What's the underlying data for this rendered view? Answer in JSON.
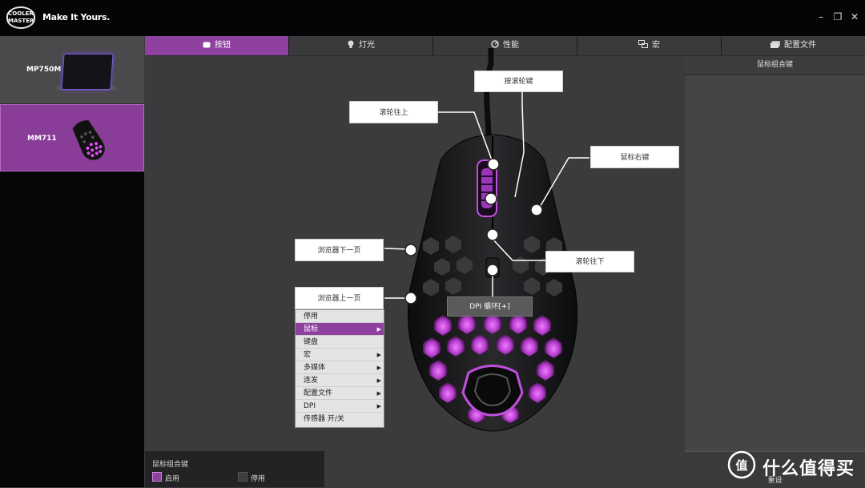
{
  "app": {
    "logo_text": "COOLER MASTER",
    "slogan": "Make It Yours."
  },
  "window_controls": {
    "minimize": "–",
    "restore": "❐",
    "close": "✕"
  },
  "devices": [
    {
      "name": "MP750M"
    },
    {
      "name": "MM711"
    }
  ],
  "tabs": [
    {
      "label": "按钮",
      "icon": "mouse-button-icon",
      "active": true
    },
    {
      "label": "灯光",
      "icon": "bulb-icon",
      "active": false
    },
    {
      "label": "性能",
      "icon": "gauge-icon",
      "active": false
    },
    {
      "label": "宏",
      "icon": "macro-icon",
      "active": false
    },
    {
      "label": "配置文件",
      "icon": "profile-icon",
      "active": false
    }
  ],
  "right_panel": {
    "header": "鼠标组合键",
    "reset_label": "重设"
  },
  "callouts": {
    "wheel_click": "按滚轮键",
    "wheel_up": "滚轮往上",
    "right_button": "鼠标右键",
    "browser_forward": "浏览器下一页",
    "wheel_down": "滚轮往下",
    "browser_back": "浏览器上一页",
    "dpi": "DPI 循环[+]"
  },
  "context_menu": [
    {
      "label": "停用",
      "submenu": false
    },
    {
      "label": "鼠标",
      "submenu": true,
      "selected": true
    },
    {
      "label": "键盘",
      "submenu": false
    },
    {
      "label": "宏",
      "submenu": true
    },
    {
      "label": "多媒体",
      "submenu": true
    },
    {
      "label": "连发",
      "submenu": true
    },
    {
      "label": "配置文件",
      "submenu": true
    },
    {
      "label": "DPI",
      "submenu": true
    },
    {
      "label": "传感器 开/关",
      "submenu": false
    }
  ],
  "combo": {
    "title": "鼠标组合键",
    "enable_label": "启用",
    "disable_label": "停用"
  },
  "watermark": {
    "text": "什么值得买",
    "icon_glyph": "值"
  },
  "colors": {
    "accent": "#8f41a0",
    "glow": "#d34df0"
  }
}
